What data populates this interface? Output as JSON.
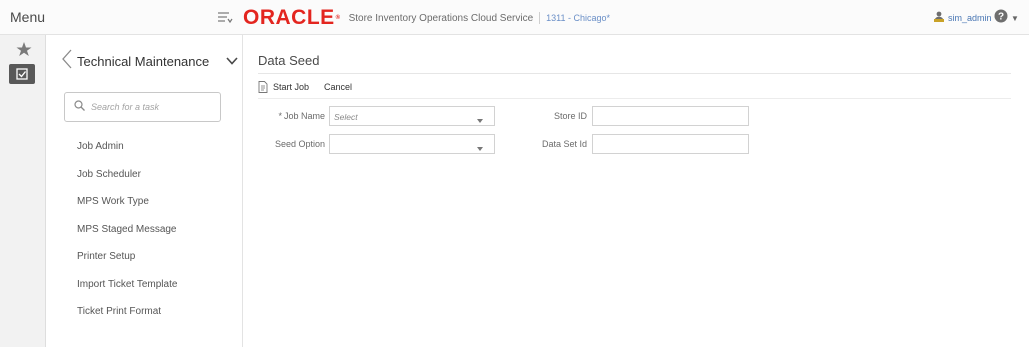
{
  "menu": {
    "label": "Menu"
  },
  "brand": {
    "logo": "ORACLE",
    "logo_mark": "®",
    "app_title": "Store Inventory Operations Cloud Service",
    "store_context": "1311 - Chicago*"
  },
  "user": {
    "name": "sim_admin"
  },
  "nav": {
    "section_title": "Technical Maintenance",
    "search_placeholder": "Search for a task",
    "tasks": [
      {
        "label": "Job Admin"
      },
      {
        "label": "Job Scheduler"
      },
      {
        "label": "MPS Work Type"
      },
      {
        "label": "MPS Staged Message"
      },
      {
        "label": "Printer Setup"
      },
      {
        "label": "Import Ticket Template"
      },
      {
        "label": "Ticket Print Format"
      }
    ]
  },
  "page": {
    "title": "Data Seed",
    "toolbar": {
      "start_job": "Start Job",
      "cancel": "Cancel"
    },
    "form": {
      "job_name_label": "Job Name",
      "job_name_required_mark": "*",
      "job_name_value": "Select",
      "seed_option_label": "Seed Option",
      "seed_option_value": "",
      "store_id_label": "Store ID",
      "store_id_value": "",
      "data_set_id_label": "Data Set Id",
      "data_set_id_value": ""
    }
  },
  "colors": {
    "brand_red": "#e3251f",
    "link_blue": "#4a77b4",
    "rail_active": "#595959"
  },
  "icons": {
    "menu_toggle": "menu-collapse-icon",
    "favorites": "star-icon",
    "tasks": "task-check-icon",
    "back": "chevron-left-icon",
    "section_expand": "chevron-down-icon",
    "search": "search-icon",
    "user": "user-icon",
    "help": "help-icon",
    "start_job": "document-icon"
  }
}
